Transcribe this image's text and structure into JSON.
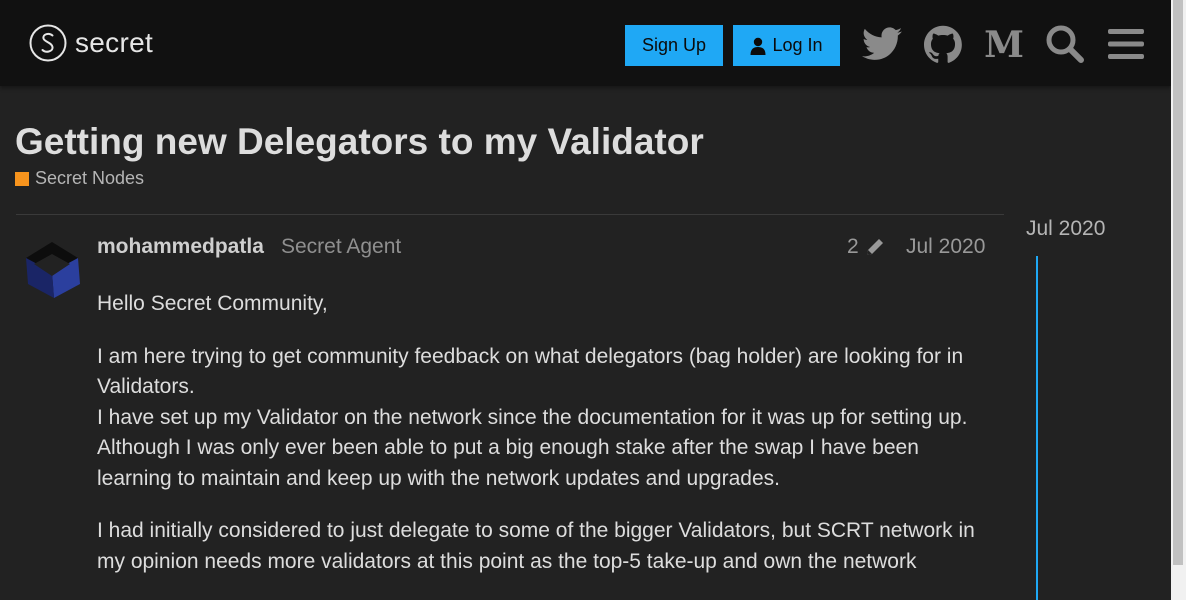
{
  "header": {
    "logo_text": "secret",
    "signup_label": "Sign Up",
    "login_label": "Log In",
    "icons": [
      "twitter-icon",
      "github-icon",
      "medium-icon",
      "search-icon",
      "hamburger-menu-icon"
    ]
  },
  "topic": {
    "title": "Getting new Delegators to my Validator",
    "category": "Secret Nodes",
    "category_color": "#f7941d"
  },
  "post": {
    "username": "mohammedpatla",
    "user_title": "Secret Agent",
    "edit_count": "2",
    "date": "Jul 2020",
    "paragraphs": [
      "Hello Secret Community,",
      "I am here trying to get community feedback on what delegators (bag holder) are looking for in Validators.",
      "I have set up my Validator on the network since the documentation for it was up for setting up.",
      "Although I was only ever been able to put a big enough stake after the swap I have been learning to maintain and keep up with the network updates and upgrades.",
      "I had initially considered to just delegate to some of the bigger Validators, but SCRT network in my opinion needs more validators at this point as the top-5 take-up and own the network"
    ]
  },
  "timeline": {
    "date": "Jul 2020"
  },
  "colors": {
    "accent": "#1fa8f5",
    "header_bg": "#111111",
    "page_bg": "#222222"
  }
}
